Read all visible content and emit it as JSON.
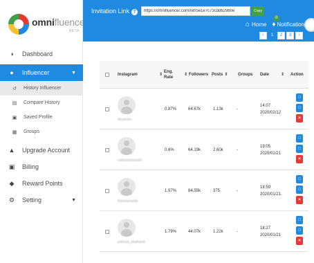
{
  "brand": {
    "name_bold": "omni",
    "name_light": "fluencer",
    "beta": "BETA"
  },
  "sidebar": {
    "items": [
      {
        "label": "Dashboard",
        "icon": "palette-icon"
      },
      {
        "label": "Influencer",
        "icon": "circle-icon"
      },
      {
        "label": "Upgrade Account",
        "icon": "megaphone-icon"
      },
      {
        "label": "Billing",
        "icon": "money-icon"
      },
      {
        "label": "Reward Points",
        "icon": "diamond-icon"
      },
      {
        "label": "Setting",
        "icon": "gear-icon"
      }
    ],
    "subitems": [
      {
        "label": "History Influencer",
        "icon": "history-icon"
      },
      {
        "label": "Compare History",
        "icon": "chart-icon"
      },
      {
        "label": "Saved Profile",
        "icon": "lock-icon"
      },
      {
        "label": "Groups",
        "icon": "briefcase-icon"
      }
    ]
  },
  "header": {
    "invitation_label": "Invitation Link",
    "invitation_url": "https://omnifluencer.com/ref/5e1e7c73cdd62980e",
    "copy_label": "Copy",
    "home_label": "Home",
    "notification_label": "Notification",
    "notification_count": "0",
    "pages": [
      "‹",
      "1",
      "2",
      "3",
      "›"
    ],
    "current_page": "1"
  },
  "table": {
    "columns": {
      "instagram": "Instagram",
      "eng_rate_1": "Eng.",
      "eng_rate_2": "Rate",
      "followers": "Followers",
      "posts": "Posts",
      "groups": "Groups",
      "date": "Date",
      "action": "Action"
    },
    "rows": [
      {
        "name": "dinatroko",
        "eng_rate": "0.87%",
        "followers": "64.67k",
        "posts": "1.13k",
        "groups": "-",
        "time": "14:07",
        "date": "2020/02/12"
      },
      {
        "name": "catherinesumitri",
        "eng_rate": "0.6%",
        "followers": "64.19k",
        "posts": "2.60k",
        "groups": "-",
        "time": "19:05",
        "date": "2020/01/21"
      },
      {
        "name": "febiolarosella",
        "eng_rate": "1.97%",
        "followers": "84.55k",
        "posts": "375",
        "groups": "-",
        "time": "18:59",
        "date": "2020/01/21"
      },
      {
        "name": "patricia_stephanie",
        "eng_rate": "1.79%",
        "followers": "44.07k",
        "posts": "1.22k",
        "groups": "-",
        "time": "18:27",
        "date": "2020/01/21"
      }
    ]
  },
  "colors": {
    "primary": "#1f8ae0",
    "success": "#43a047",
    "danger": "#e53935"
  }
}
